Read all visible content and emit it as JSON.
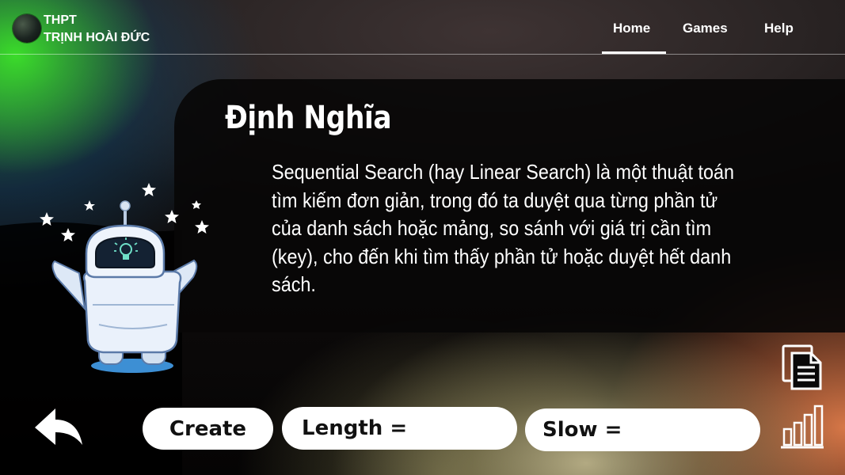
{
  "brand": {
    "line1": "THPT",
    "line2": "TRỊNH HOÀI ĐỨC"
  },
  "nav": {
    "items": [
      {
        "label": "Home",
        "active": true
      },
      {
        "label": "Games",
        "active": false
      },
      {
        "label": "Help",
        "active": false
      }
    ]
  },
  "content": {
    "title": "Định Nghĩa",
    "definition_lines": [
      "Sequential Search (hay Linear Search) là một thuật toán",
      "tìm kiếm đơn giản, trong đó ta duyệt qua từng phần tử",
      "của danh sách hoặc mảng, so sánh với giá trị cần tìm",
      "(key), cho đến khi tìm thấy phần tử hoặc duyệt hết danh",
      "sách."
    ]
  },
  "controls": {
    "create_label": "Create",
    "length_label": "Length =",
    "length_value": "",
    "slow_label": "Slow =",
    "slow_value": ""
  },
  "icons": {
    "back": "back-arrow-icon",
    "document": "document-icon",
    "chart": "bar-chart-icon",
    "mascot": "robot-mascot"
  },
  "colors": {
    "accent_green": "#3bdc2a",
    "accent_orange": "#e07d4b",
    "pill_background": "#ffffff"
  }
}
